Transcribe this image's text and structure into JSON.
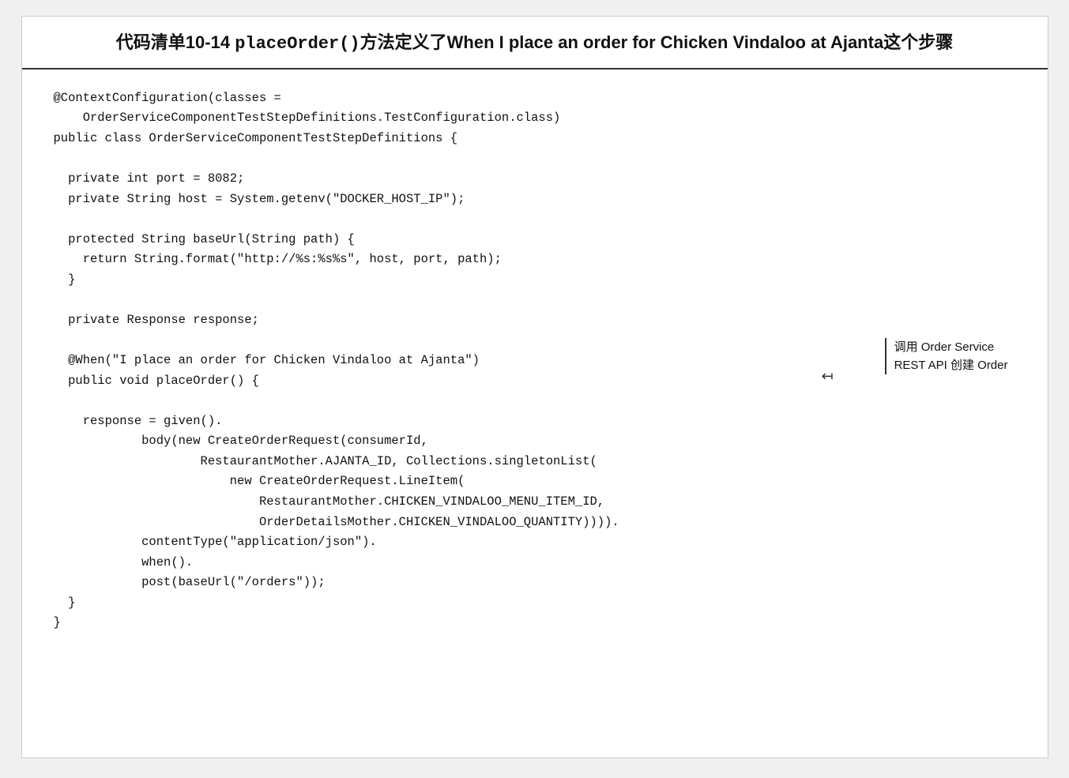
{
  "title": {
    "prefix": "代码清单10-14  ",
    "method": "placeOrder()",
    "suffix_zh": "方法定义了",
    "suffix_en": "When I place an order for Chicken Vindaloo at Ajanta",
    "suffix_zh2": "这个步骤"
  },
  "code": {
    "lines": [
      "@ContextConfiguration(classes =",
      "    OrderServiceComponentTestStepDefinitions.TestConfiguration.class)",
      "public class OrderServiceComponentTestStepDefinitions {",
      "",
      "  private int port = 8082;",
      "  private String host = System.getenv(\"DOCKER_HOST_IP\");",
      "",
      "  protected String baseUrl(String path) {",
      "    return String.format(\"http://%s:%s%s\", host, port, path);",
      "  }",
      "",
      "  private Response response;",
      "",
      "  @When(\"I place an order for Chicken Vindaloo at Ajanta\")",
      "  public void placeOrder() {",
      "",
      "    response = given().",
      "            body(new CreateOrderRequest(consumerId,",
      "                    RestaurantMother.AJANTA_ID, Collections.singletonList(",
      "                        new CreateOrderRequest.LineItem(",
      "                            RestaurantMother.CHICKEN_VINDALOO_MENU_ITEM_ID,",
      "                            OrderDetailsMother.CHICKEN_VINDALOO_QUANTITY)))).",
      "            contentType(\"application/json\").",
      "            when().",
      "            post(baseUrl(\"/orders\"));",
      "  }",
      "}"
    ]
  },
  "annotation": {
    "line1": "调用 Order Service",
    "line2": "REST API 创建 Order"
  }
}
